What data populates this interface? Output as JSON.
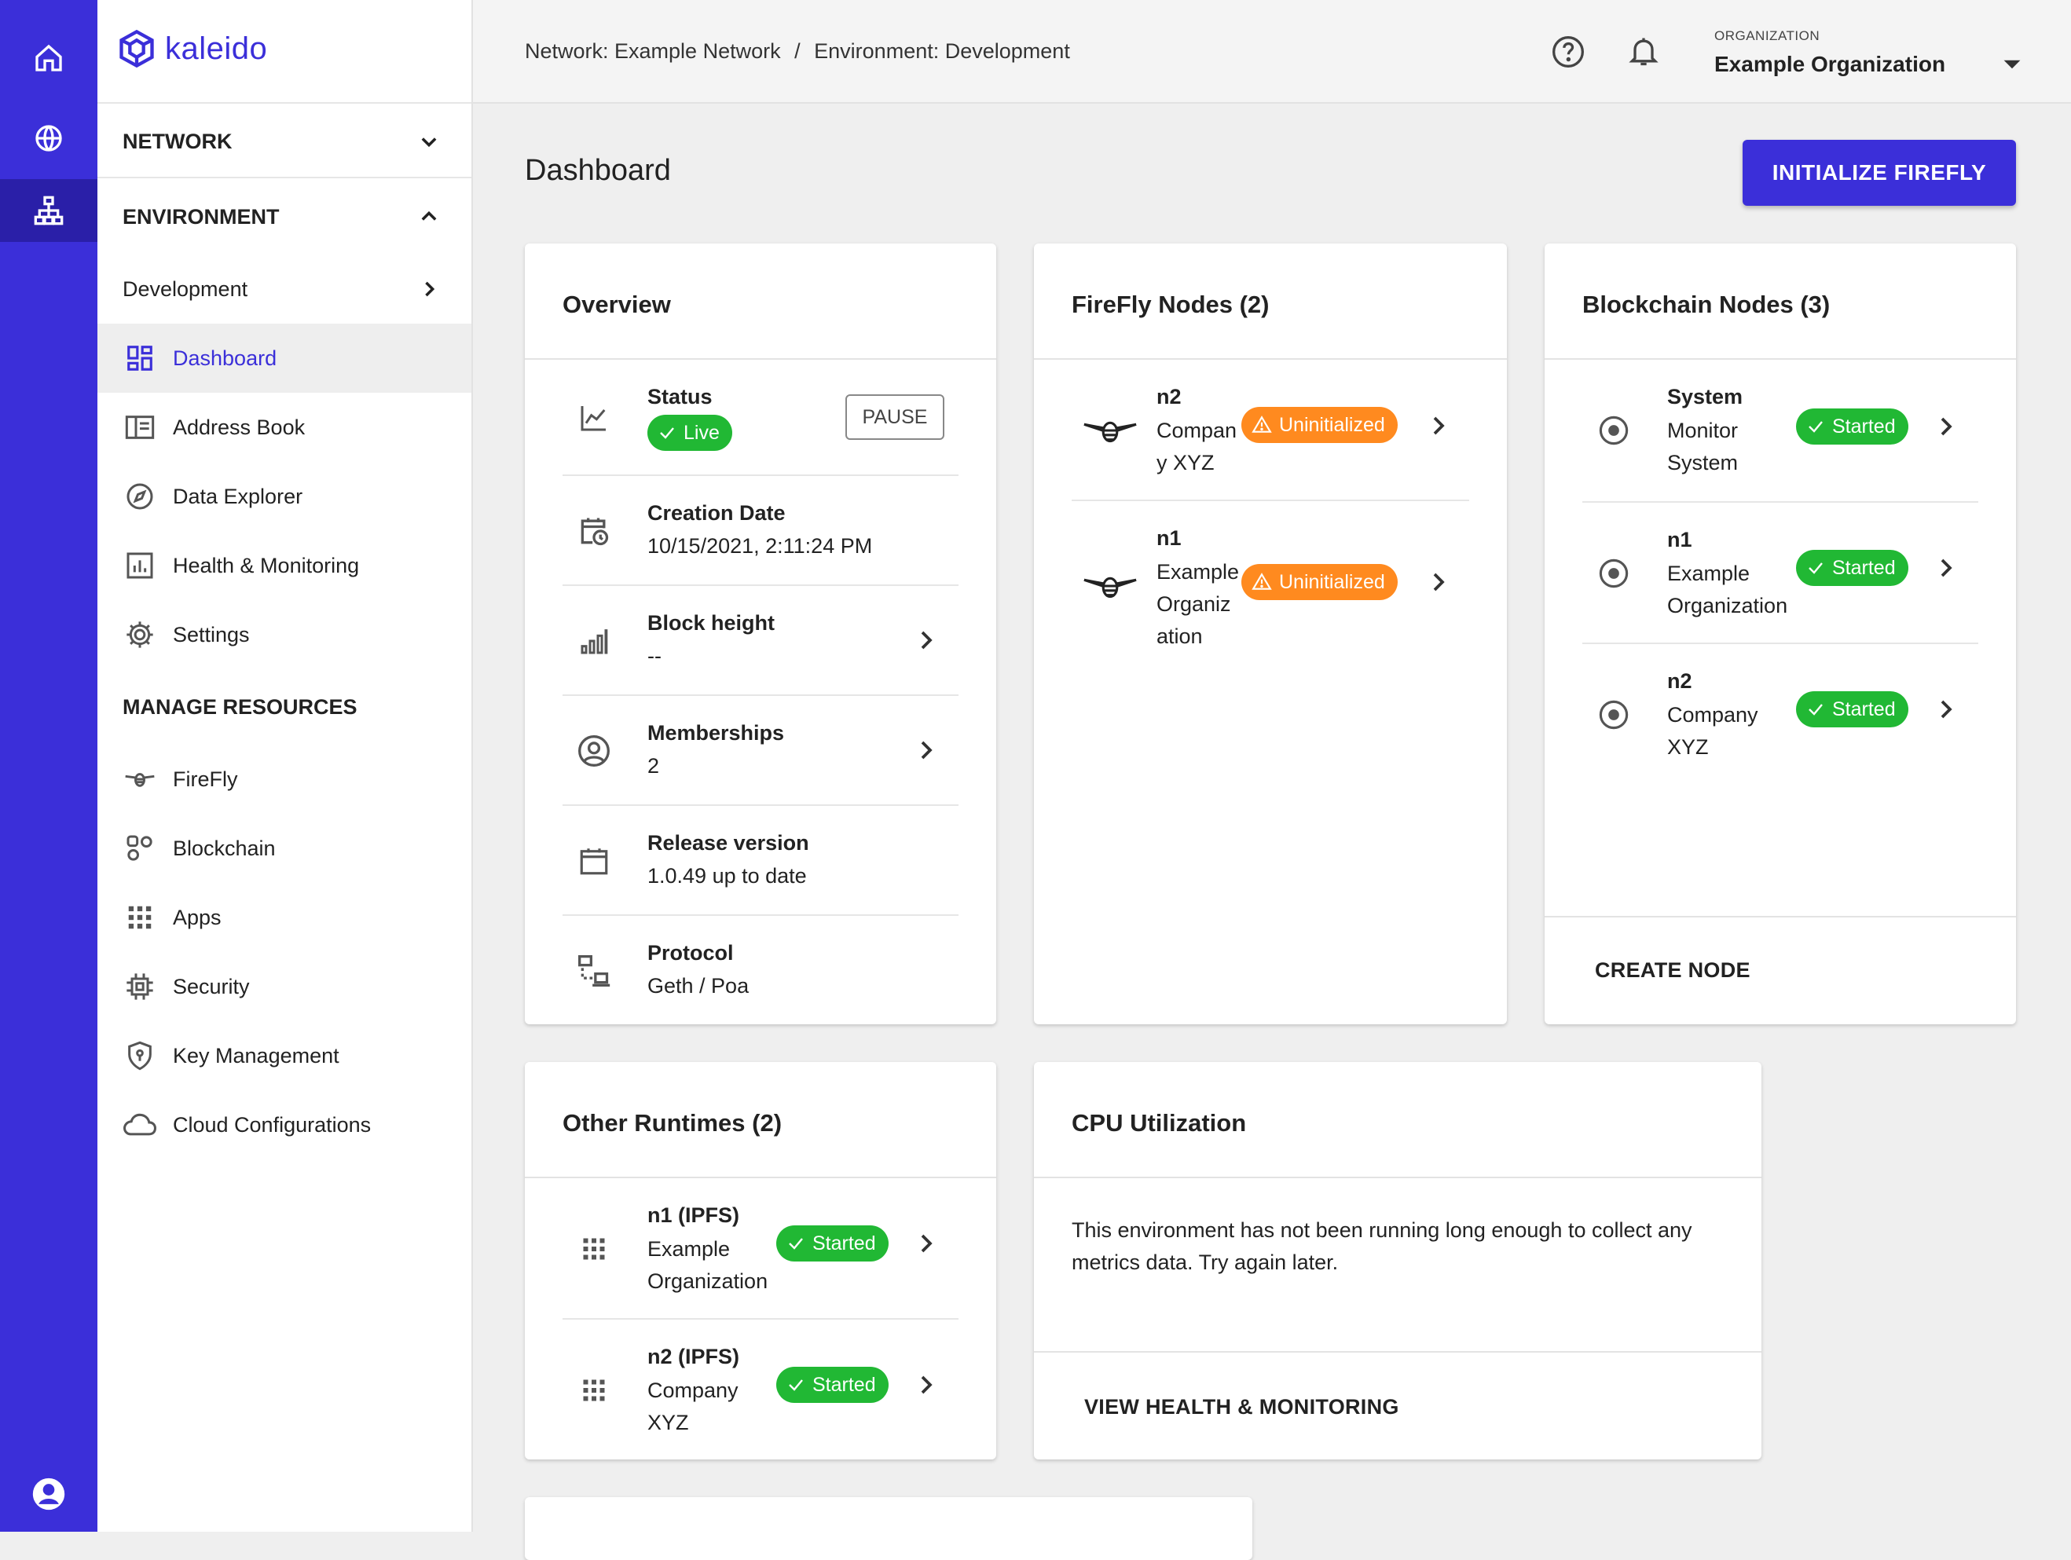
{
  "brand": {
    "name": "kaleido",
    "color": "#3b2fd9"
  },
  "rail": [
    {
      "icon": "home-icon"
    },
    {
      "icon": "globe-icon"
    },
    {
      "icon": "network-icon"
    },
    {
      "icon": "account-icon"
    }
  ],
  "sidebar": {
    "network_label": "NETWORK",
    "environment_label": "ENVIRONMENT",
    "env_name": "Development",
    "items": [
      {
        "label": "Dashboard",
        "icon": "dashboard-icon"
      },
      {
        "label": "Address Book",
        "icon": "address-book-icon"
      },
      {
        "label": "Data Explorer",
        "icon": "compass-icon"
      },
      {
        "label": "Health & Monitoring",
        "icon": "chart-icon"
      },
      {
        "label": "Settings",
        "icon": "gear-icon"
      }
    ],
    "manage_label": "MANAGE RESOURCES",
    "resources": [
      {
        "label": "FireFly",
        "icon": "firefly-icon"
      },
      {
        "label": "Blockchain",
        "icon": "blockchain-icon"
      },
      {
        "label": "Apps",
        "icon": "apps-grid-icon"
      },
      {
        "label": "Security",
        "icon": "chip-icon"
      },
      {
        "label": "Key Management",
        "icon": "shield-key-icon"
      },
      {
        "label": "Cloud Configurations",
        "icon": "cloud-icon"
      }
    ]
  },
  "topbar": {
    "crumb_network": "Network: Example Network",
    "crumb_sep": "/",
    "crumb_env": "Environment: Development",
    "org_label": "ORGANIZATION",
    "org_name": "Example Organization"
  },
  "page": {
    "title": "Dashboard",
    "init_button": "INITIALIZE FIREFLY"
  },
  "overview": {
    "title": "Overview",
    "status_label": "Status",
    "status_value": "Live",
    "pause_label": "PAUSE",
    "creation_label": "Creation Date",
    "creation_value": "10/15/2021, 2:11:24 PM",
    "block_label": "Block height",
    "block_value": "--",
    "memberships_label": "Memberships",
    "memberships_value": "2",
    "release_label": "Release version",
    "release_value": "1.0.49 up to date",
    "protocol_label": "Protocol",
    "protocol_value": "Geth / Poa"
  },
  "firefly": {
    "title": "FireFly Nodes (2)",
    "nodes": [
      {
        "name": "n2",
        "org_line1": "Compan",
        "org_line2": "y XYZ",
        "org_line3": "",
        "status": "Uninitialized"
      },
      {
        "name": "n1",
        "org_line1": "Example",
        "org_line2": "Organiz",
        "org_line3": "ation",
        "status": "Uninitialized"
      }
    ]
  },
  "blockchain": {
    "title": "Blockchain Nodes (3)",
    "nodes": [
      {
        "name": "System",
        "org_line1": "Monitor",
        "org_line2": "System",
        "status": "Started"
      },
      {
        "name": "n1",
        "org_line1": "Example",
        "org_line2": "Organization",
        "status": "Started"
      },
      {
        "name": "n2",
        "org_line1": "Company",
        "org_line2": "XYZ",
        "status": "Started"
      }
    ],
    "create_label": "CREATE NODE"
  },
  "runtimes": {
    "title": "Other Runtimes (2)",
    "items": [
      {
        "name": "n1 (IPFS)",
        "org_line1": "Example",
        "org_line2": "Organization",
        "status": "Started"
      },
      {
        "name": "n2 (IPFS)",
        "org_line1": "Company",
        "org_line2": "XYZ",
        "status": "Started"
      }
    ]
  },
  "cpu": {
    "title": "CPU Utilization",
    "message_line1": "This environment has not been running long enough to collect any",
    "message_line2": "metrics data. Try again later.",
    "link_label": "VIEW HEALTH & MONITORING"
  },
  "colors": {
    "accent": "#3b2fd9",
    "green": "#21b834",
    "orange": "#ff8a1f"
  }
}
